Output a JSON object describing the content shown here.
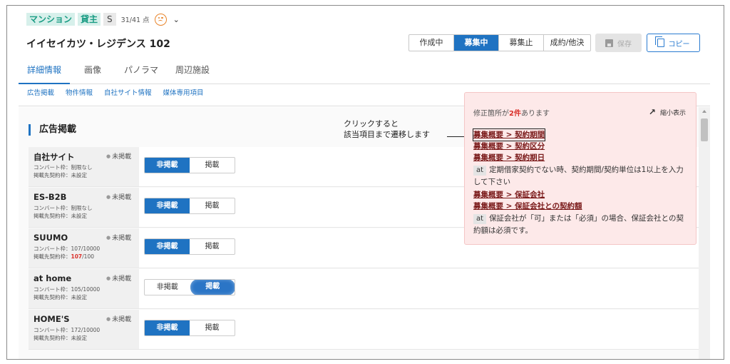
{
  "header": {
    "tags": [
      "マンション",
      "貸主",
      "S"
    ],
    "score": "31/41 点",
    "title": "イイセイカツ・レジデンス 102"
  },
  "status_buttons": [
    "作成中",
    "募集中",
    "募集止",
    "成約/他決"
  ],
  "status_active": "募集中",
  "save_label": "保存",
  "copy_label": "コピー",
  "tabs": [
    "詳細情報",
    "画像",
    "パノラマ",
    "周辺施設"
  ],
  "subnav": [
    "広告掲載",
    "物件情報",
    "自社サイト情報",
    "媒体専用項目"
  ],
  "section_title": "広告掲載",
  "media": [
    {
      "name": "自社サイト",
      "state": "未掲載",
      "line1": "コンバート枠：制限なし",
      "line2_label": "掲載先契約枠：",
      "line2_value": "未設定",
      "line2_extra": "",
      "toggle_off": "非掲載",
      "toggle_on": "掲載",
      "selected": "非掲載"
    },
    {
      "name": "ES-B2B",
      "state": "未掲載",
      "line1": "コンバート枠：制限なし",
      "line2_label": "掲載先契約枠：",
      "line2_value": "未設定",
      "line2_extra": "",
      "toggle_off": "非掲載",
      "toggle_on": "掲載",
      "selected": "非掲載"
    },
    {
      "name": "SUUMO",
      "state": "未掲載",
      "line1": "コンバート枠：107/10000",
      "line2_label": "掲載先契約枠：",
      "line2_value": "107",
      "line2_extra": "/100",
      "toggle_off": "非掲載",
      "toggle_on": "掲載",
      "selected": "非掲載"
    },
    {
      "name": "at home",
      "state": "未掲載",
      "line1": "コンバート枠：105/10000",
      "line2_label": "掲載先契約枠：",
      "line2_value": "未設定",
      "line2_extra": "",
      "toggle_off": "非掲載",
      "toggle_on": "掲載",
      "selected": "掲載"
    },
    {
      "name": "HOME'S",
      "state": "未掲載",
      "line1": "コンバート枠：172/10000",
      "line2_label": "掲載先契約枠：",
      "line2_value": "未設定",
      "line2_extra": "",
      "toggle_off": "非掲載",
      "toggle_on": "掲載",
      "selected": "非掲載"
    }
  ],
  "callout": [
    "クリックすると",
    "該当項目まで遷移します"
  ],
  "errors": {
    "head_prefix": "修正箇所が",
    "head_count": "2件",
    "head_suffix": "あります",
    "minimize": "縮小表示",
    "items": [
      {
        "link": "募集概要 > 契約期間"
      },
      {
        "link": "募集概要 > 契約区分"
      },
      {
        "link": "募集概要 > 契約期日"
      },
      {
        "tag": "at",
        "msg": "定期借家契約でない時、契約期間/契約単位は1以上を入力して下さい"
      },
      {
        "link": "募集概要 > 保証会社"
      },
      {
        "link": "募集概要 > 保証会社との契約額"
      },
      {
        "tag": "at",
        "msg": "保証会社が「可」または「必須」の場合、保証会社との契約額は必須です。"
      }
    ]
  },
  "colors": {
    "accent": "#1f73c2",
    "teal": "#1a9c84",
    "error_bg": "#fde9e9",
    "error_text": "#d9302a"
  }
}
